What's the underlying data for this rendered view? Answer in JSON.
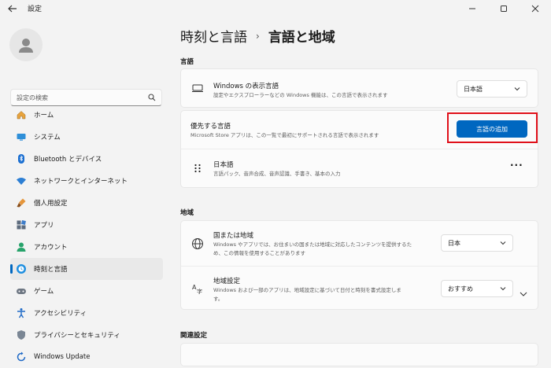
{
  "window": {
    "app_title": "設定"
  },
  "sidebar": {
    "search_placeholder": "設定の検索",
    "items": [
      {
        "label": "ホーム",
        "icon": "home-icon"
      },
      {
        "label": "システム",
        "icon": "system-icon"
      },
      {
        "label": "Bluetooth とデバイス",
        "icon": "bluetooth-icon"
      },
      {
        "label": "ネットワークとインターネット",
        "icon": "wifi-icon"
      },
      {
        "label": "個人用設定",
        "icon": "brush-icon"
      },
      {
        "label": "アプリ",
        "icon": "apps-icon"
      },
      {
        "label": "アカウント",
        "icon": "account-icon"
      },
      {
        "label": "時刻と言語",
        "icon": "clock-globe-icon",
        "active": true
      },
      {
        "label": "ゲーム",
        "icon": "gamepad-icon"
      },
      {
        "label": "アクセシビリティ",
        "icon": "accessibility-icon"
      },
      {
        "label": "プライバシーとセキュリティ",
        "icon": "shield-icon"
      },
      {
        "label": "Windows Update",
        "icon": "update-icon"
      }
    ]
  },
  "header": {
    "parent": "時刻と言語",
    "separator": "›",
    "current": "言語と地域"
  },
  "language_section": {
    "title": "言語",
    "display_language": {
      "title": "Windows の表示言語",
      "desc": "設定やエクスプローラーなどの Windows 機能は、この言語で表示されます",
      "value": "日本語"
    },
    "preferred": {
      "title": "優先する言語",
      "desc": "Microsoft Store アプリは、この一覧で最初にサポートされる言語で表示されます",
      "button": "言語の追加"
    },
    "japanese": {
      "title": "日本語",
      "desc": "言語パック、音声合成、音声認識、手書き、基本の入力",
      "more": "···"
    }
  },
  "region_section": {
    "title": "地域",
    "country": {
      "title": "国または地域",
      "desc1": "Windows やアプリでは、お住まいの国または地域に対応したコンテンツを提供するた",
      "desc2": "め、この情報を使用することがあります",
      "value": "日本"
    },
    "format": {
      "title": "地域設定",
      "desc1": "Windows および一部のアプリは、地域設定に基づいて日付と時刻を書式設定しま",
      "desc2": "す。",
      "value": "おすすめ"
    }
  },
  "related_section": {
    "title": "関連設定"
  },
  "colors": {
    "accent": "#0067c0",
    "highlight": "#e0101a"
  }
}
